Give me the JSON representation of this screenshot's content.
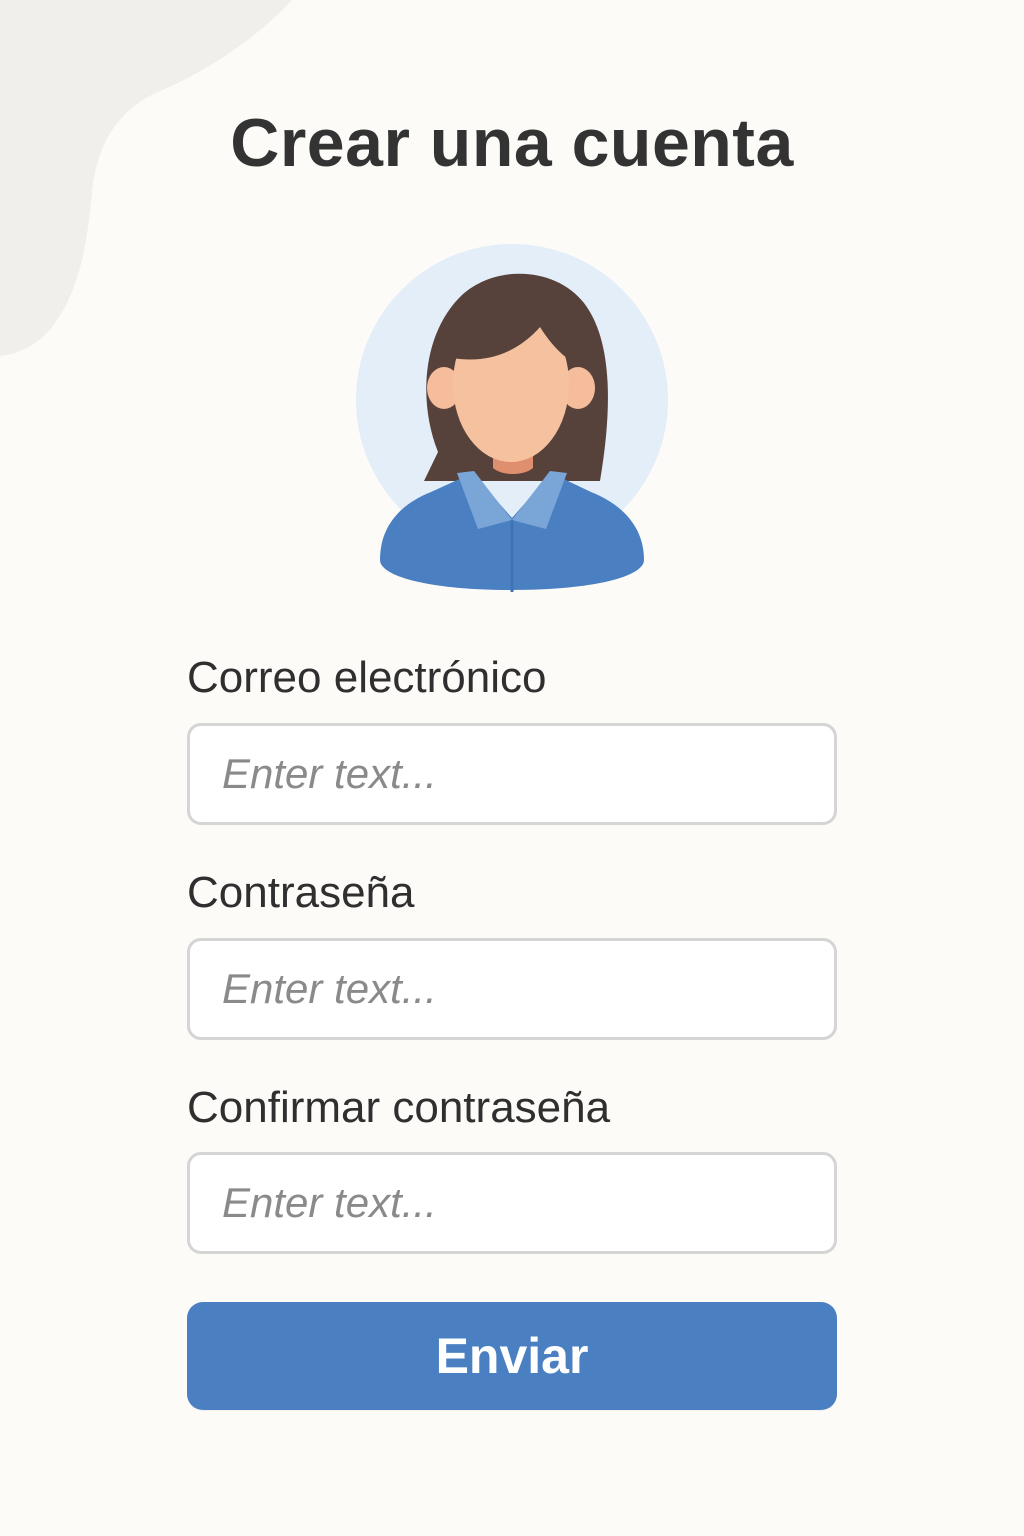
{
  "page": {
    "title": "Crear una cuenta",
    "background_color": "#fcfbf8",
    "accent_color": "#4a80c2"
  },
  "avatar": {
    "icon": "user-avatar-icon"
  },
  "form": {
    "fields": [
      {
        "label": "Correo electrónico",
        "placeholder": "Enter text..."
      },
      {
        "label": "Contraseña",
        "placeholder": "Enter text..."
      },
      {
        "label": "Confirmar contraseña",
        "placeholder": "Enter text..."
      }
    ],
    "submit_label": "Enviar"
  }
}
